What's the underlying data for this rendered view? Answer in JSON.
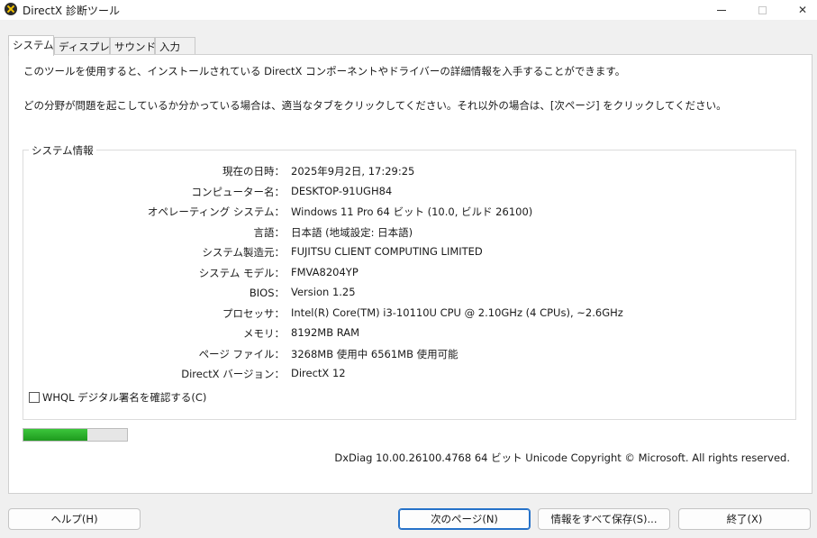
{
  "window": {
    "title": "DirectX 診断ツール"
  },
  "tabs": [
    {
      "label": "システム"
    },
    {
      "label": "ディスプレイ"
    },
    {
      "label": "サウンド"
    },
    {
      "label": "入力"
    }
  ],
  "intro": {
    "line1": "このツールを使用すると、インストールされている DirectX コンポーネントやドライバーの詳細情報を入手することができます。",
    "line2": "どの分野が問題を起こしているか分かっている場合は、適当なタブをクリックしてください。それ以外の場合は、[次ページ] をクリックしてください。"
  },
  "system_info": {
    "group_label": "システム情報",
    "rows": [
      {
        "label": "現在の日時：",
        "value": "2025年9月2日, 17:29:25"
      },
      {
        "label": "コンピューター名：",
        "value": "DESKTOP-91UGH84"
      },
      {
        "label": "オペレーティング システム：",
        "value": "Windows 11 Pro 64 ビット (10.0, ビルド 26100)"
      },
      {
        "label": "言語：",
        "value": "日本語 (地域設定: 日本語)"
      },
      {
        "label": "システム製造元：",
        "value": "FUJITSU CLIENT COMPUTING LIMITED"
      },
      {
        "label": "システム モデル：",
        "value": "FMVA8204YP"
      },
      {
        "label": "BIOS：",
        "value": "Version 1.25"
      },
      {
        "label": "プロセッサ：",
        "value": "Intel(R) Core(TM) i3-10110U CPU @ 2.10GHz (4 CPUs), ~2.6GHz"
      },
      {
        "label": "メモリ：",
        "value": "8192MB RAM"
      },
      {
        "label": "ページ ファイル：",
        "value": "3268MB 使用中 6561MB 使用可能"
      },
      {
        "label": "DirectX バージョン：",
        "value": "DirectX 12"
      }
    ],
    "checkbox_label": "WHQL デジタル署名を確認する(C)",
    "checkbox_checked": false
  },
  "progress": {
    "fraction": 0.62,
    "color": "#2aaa2a"
  },
  "footer_text": "DxDiag 10.00.26100.4768 64 ビット Unicode  Copyright © Microsoft. All rights reserved.",
  "buttons": {
    "help": "ヘルプ(H)",
    "next": "次のページ(N)",
    "save": "情報をすべて保存(S)...",
    "exit": "終了(X)"
  },
  "icons": {
    "app": "directx-icon",
    "minimize": "minimize-icon",
    "maximize": "maximize-icon",
    "close": "close-icon"
  }
}
